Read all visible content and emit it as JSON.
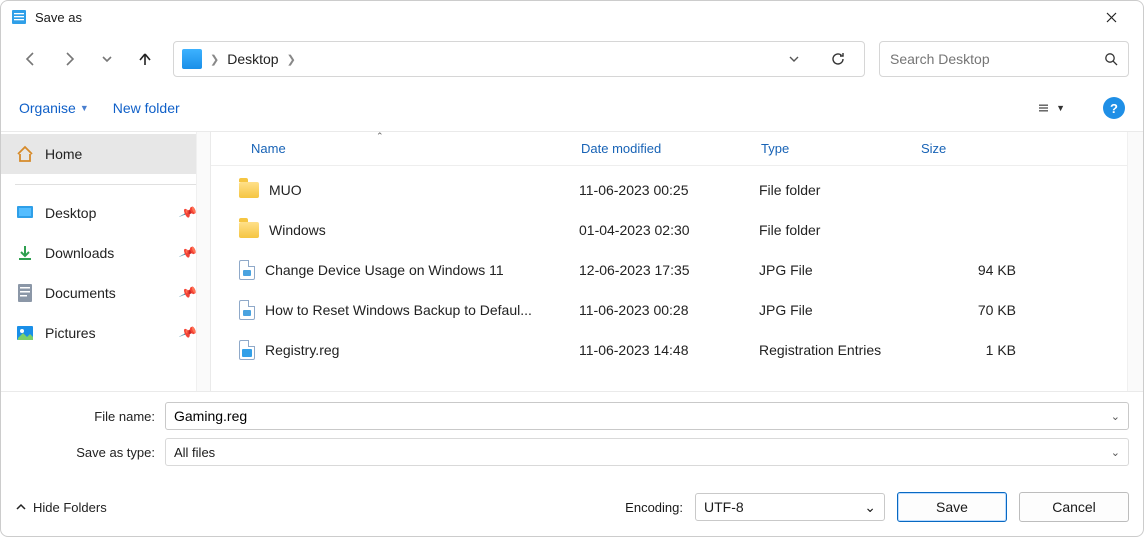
{
  "window": {
    "title": "Save as"
  },
  "nav": {
    "breadcrumb": "Desktop",
    "search_placeholder": "Search Desktop"
  },
  "toolbar": {
    "organise": "Organise",
    "new_folder": "New folder"
  },
  "sidebar": {
    "home": "Home",
    "items": [
      {
        "label": "Desktop"
      },
      {
        "label": "Downloads"
      },
      {
        "label": "Documents"
      },
      {
        "label": "Pictures"
      }
    ]
  },
  "columns": {
    "name": "Name",
    "date": "Date modified",
    "type": "Type",
    "size": "Size"
  },
  "files": [
    {
      "name": "MUO",
      "date": "11-06-2023 00:25",
      "type": "File folder",
      "size": "",
      "kind": "folder"
    },
    {
      "name": "Windows",
      "date": "01-04-2023 02:30",
      "type": "File folder",
      "size": "",
      "kind": "folder"
    },
    {
      "name": "Change Device Usage on Windows 11",
      "date": "12-06-2023 17:35",
      "type": "JPG File",
      "size": "94 KB",
      "kind": "jpg"
    },
    {
      "name": "How to Reset Windows Backup to Defaul...",
      "date": "11-06-2023 00:28",
      "type": "JPG File",
      "size": "70 KB",
      "kind": "jpg"
    },
    {
      "name": "Registry.reg",
      "date": "11-06-2023 14:48",
      "type": "Registration Entries",
      "size": "1 KB",
      "kind": "reg"
    }
  ],
  "form": {
    "filename_label": "File name:",
    "filename_value": "Gaming.reg",
    "savetype_label": "Save as type:",
    "savetype_value": "All files"
  },
  "footer": {
    "hide_folders": "Hide Folders",
    "encoding_label": "Encoding:",
    "encoding_value": "UTF-8",
    "save": "Save",
    "cancel": "Cancel"
  }
}
